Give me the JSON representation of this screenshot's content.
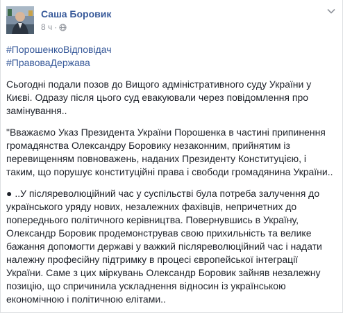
{
  "post": {
    "author": "Саша Боровик",
    "time": "8 ч",
    "separator": "·",
    "privacy_icon": "globe-icon",
    "menu_icon": "chevron-down-icon",
    "hashtags": [
      "#ПорошенкоВідповідач",
      "#ПравоваДержава"
    ],
    "paragraphs": [
      "Сьогодні подали позов до Вищого адміністративного суду України у Києві. Одразу після цього суд евакуювали через повідомлення про замінування..",
      "\"Вважаємо Указ Президента України Порошенка в частині припинення громадянства Олександру Боровику незаконним, прийнятим із перевищенням повноважень, наданих Президенту Конституцією, і таким, що порушує конституційні права і свободи громадянина України..",
      "● ..У післяреволюційний час у суспільстві була потреба залучення до українського уряду нових, незалежних фахівців, непричетних до попереднього політичного керівництва. Повернувшись в Україну, Олександр Боровик продемонстрував свою прихильність та велике бажання допомогти державі у важкий післяреволюційний час і надати належну професійну підтримку в процесі європейської інтеграції України. Саме з цих міркувань Олександр Боровик зайняв незалежну позицію, що спричинила ускладнення відносин із українською економічною і політичною елітами.."
    ]
  },
  "colors": {
    "link": "#365899",
    "text": "#1d2129",
    "meta": "#90949c",
    "border": "#dddfe2"
  }
}
